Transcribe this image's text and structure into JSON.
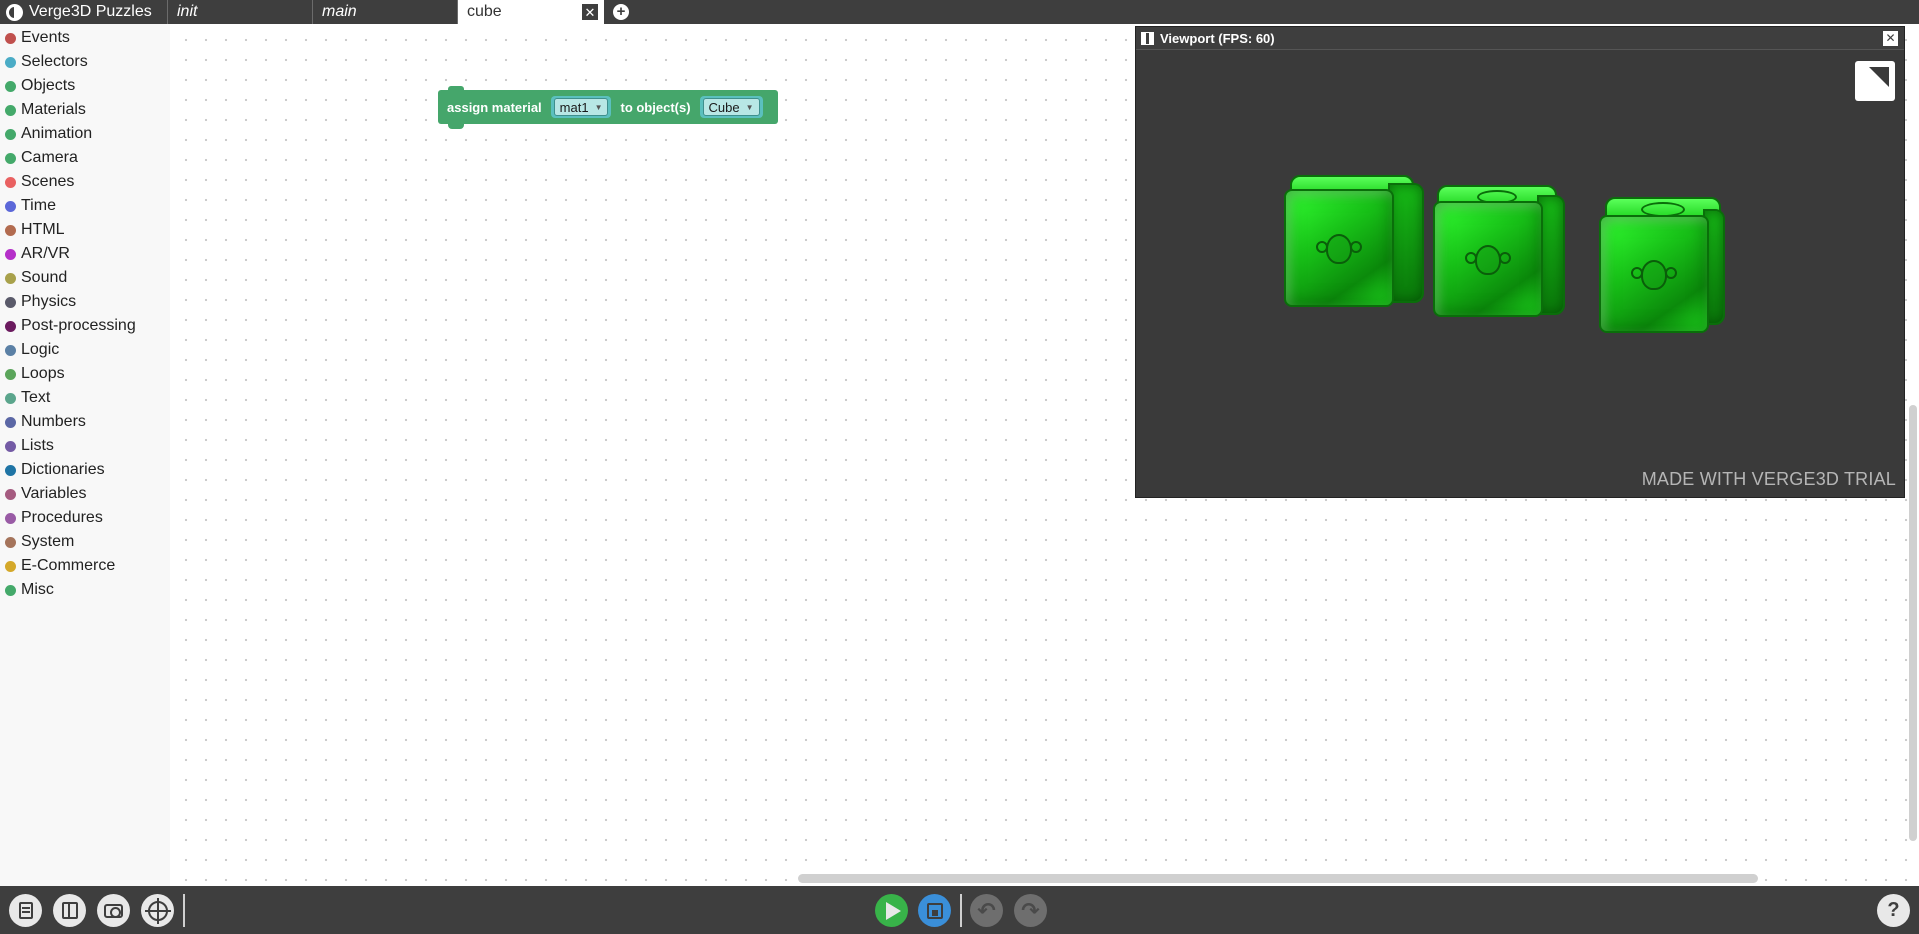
{
  "app": {
    "title": "Verge3D Puzzles",
    "logo_icon": "verge3d-logo-icon"
  },
  "tabs": [
    {
      "label": "init",
      "active": false
    },
    {
      "label": "main",
      "active": false
    },
    {
      "label": "cube",
      "active": true
    }
  ],
  "tab_close_glyph": "✕",
  "tab_add_glyph": "+",
  "categories": [
    {
      "label": "Events",
      "color": "#c0504d"
    },
    {
      "label": "Selectors",
      "color": "#4bacc6"
    },
    {
      "label": "Objects",
      "color": "#44a96a"
    },
    {
      "label": "Materials",
      "color": "#44a96a"
    },
    {
      "label": "Animation",
      "color": "#44a96a"
    },
    {
      "label": "Camera",
      "color": "#44a96a"
    },
    {
      "label": "Scenes",
      "color": "#e96161"
    },
    {
      "label": "Time",
      "color": "#5b67d8"
    },
    {
      "label": "HTML",
      "color": "#b26b4f"
    },
    {
      "label": "AR/VR",
      "color": "#b530c9"
    },
    {
      "label": "Sound",
      "color": "#a8a14b"
    },
    {
      "label": "Physics",
      "color": "#5a5a6a"
    },
    {
      "label": "Post-processing",
      "color": "#6b1b5f"
    },
    {
      "label": "Logic",
      "color": "#5b80a5"
    },
    {
      "label": "Loops",
      "color": "#5ba55b"
    },
    {
      "label": "Text",
      "color": "#5ba58c"
    },
    {
      "label": "Numbers",
      "color": "#5b67a5"
    },
    {
      "label": "Lists",
      "color": "#745ba5"
    },
    {
      "label": "Dictionaries",
      "color": "#1f74a5"
    },
    {
      "label": "Variables",
      "color": "#a55b80"
    },
    {
      "label": "Procedures",
      "color": "#995ba5"
    },
    {
      "label": "System",
      "color": "#a5745b"
    },
    {
      "label": "E-Commerce",
      "color": "#d4a82a"
    },
    {
      "label": "Misc",
      "color": "#44a96a"
    }
  ],
  "block": {
    "text1": "assign material",
    "material": "mat1",
    "text2": "to object(s)",
    "object": "Cube",
    "color": "#45a66b"
  },
  "viewport": {
    "title": "Viewport (FPS: 60)",
    "close_glyph": "✕",
    "watermark": "MADE WITH VERGE3D TRIAL"
  },
  "toolbar": {
    "undo_glyph": "↶",
    "redo_glyph": "↷",
    "help_glyph": "?",
    "play_color": "#38b349",
    "save_color": "#3a8fd9"
  }
}
